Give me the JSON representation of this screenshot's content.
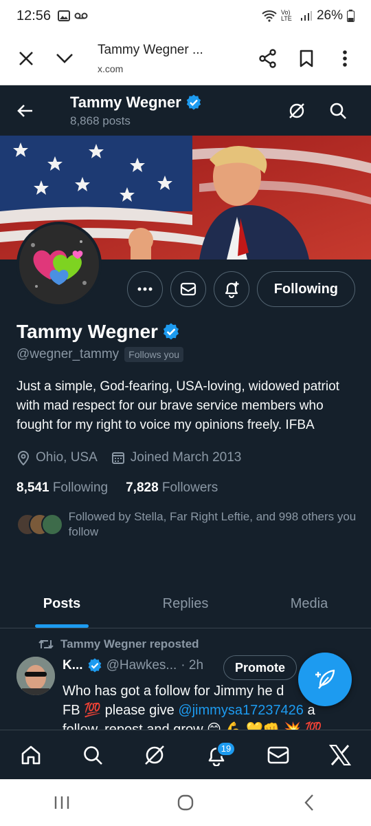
{
  "status_bar": {
    "time": "12:56",
    "battery": "26%",
    "network": "Vo) LTE"
  },
  "browser": {
    "page_title": "Tammy Wegner ...",
    "url": "x.com"
  },
  "header": {
    "name": "Tammy Wegner",
    "posts_count": "8,868 posts"
  },
  "profile": {
    "name": "Tammy Wegner",
    "handle": "@wegner_tammy",
    "follows_you": "Follows you",
    "bio": "Just a simple, God-fearing, USA-loving, widowed patriot with mad respect for our brave service members who fought for my right to voice my opinions freely. IFBA",
    "location": "Ohio, USA",
    "joined": "Joined March 2013",
    "following_count": "8,541",
    "following_label": "Following",
    "followers_count": "7,828",
    "followers_label": "Followers",
    "followed_by": "Followed by Stella, Far Right Leftie, and 998 others you follow",
    "follow_button": "Following"
  },
  "tabs": [
    "Posts",
    "Replies",
    "Media"
  ],
  "post": {
    "repost_label": "Tammy Wegner reposted",
    "author_name": "K...",
    "author_handle": "@Hawkes...",
    "time": "· 2h",
    "promote_label": "Promote",
    "text_start": "Who has got a follow for Jimmy he d",
    "text_line2_start": "FB 💯 please give ",
    "mention": "@jimmysa17237426",
    "text_line2_end": " a",
    "text_line3": "follow, repost and grow 😊 💪 💛👊 💥 💯"
  },
  "bottom_nav": {
    "notification_badge": "19"
  },
  "colors": {
    "background": "#15202b",
    "accent": "#1d9bf0",
    "muted": "#8b98a5"
  }
}
